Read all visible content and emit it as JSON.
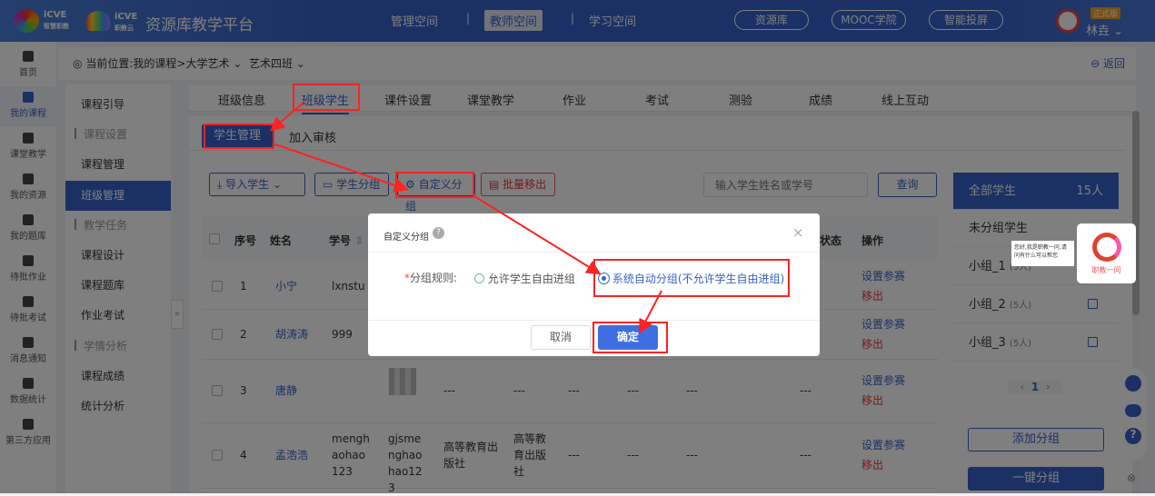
{
  "header": {
    "brand1": "iCVE",
    "brand1_sub": "智慧职教",
    "brand2": "iCVE",
    "brand2_sub": "职教云",
    "title": "资源库教学平台",
    "nav": [
      {
        "label": "管理空间"
      },
      {
        "label": "教师空间",
        "active": true
      },
      {
        "label": "学习空间"
      }
    ],
    "pills": [
      "资源库",
      "MOOC学院",
      "智能投屏"
    ],
    "badge": "正式版",
    "user": "林垚",
    "accent": "#3761c8"
  },
  "sidebar": [
    {
      "label": "首页",
      "icon": "home-icon"
    },
    {
      "label": "我的课程",
      "icon": "book-icon",
      "active": true
    },
    {
      "label": "课堂教学",
      "icon": "play-icon"
    },
    {
      "label": "我的资源",
      "icon": "library-icon"
    },
    {
      "label": "我的题库",
      "icon": "question-bank-icon"
    },
    {
      "label": "待批作业",
      "icon": "homework-icon"
    },
    {
      "label": "待批考试",
      "icon": "exam-icon"
    },
    {
      "label": "消息通知",
      "icon": "message-icon"
    },
    {
      "label": "数据统计",
      "icon": "stats-icon"
    },
    {
      "label": "第三方应用",
      "icon": "apps-icon"
    }
  ],
  "subnav": [
    {
      "label": "课程引导"
    },
    {
      "label": "课程设置",
      "section": true
    },
    {
      "label": "课程管理"
    },
    {
      "label": "班级管理",
      "active": true
    },
    {
      "label": "教学任务",
      "section": true
    },
    {
      "label": "课程设计"
    },
    {
      "label": "课程题库"
    },
    {
      "label": "作业考试"
    },
    {
      "label": "学情分析",
      "section": true
    },
    {
      "label": "课程成绩"
    },
    {
      "label": "统计分析"
    }
  ],
  "breadcrumb": {
    "prefix": "当前位置:",
    "course": "我的课程",
    "sep": ">",
    "subject": "大学艺术",
    "class": "艺术四班",
    "back": "返回"
  },
  "tabs": [
    "班级信息",
    "班级学生",
    "课件设置",
    "课堂教学",
    "作业",
    "考试",
    "测验",
    "成绩",
    "线上互动"
  ],
  "subtabs": [
    "学生管理",
    "加入审核"
  ],
  "toolbar": {
    "import": "导入学生",
    "group": "学生分组",
    "custom": "自定义分组",
    "remove": "批量移出",
    "search_placeholder": "输入学生姓名或学号",
    "query": "查询"
  },
  "table": {
    "headers": {
      "no": "序号",
      "name": "姓名",
      "id": "学号",
      "status": "状态",
      "ops": "操作"
    },
    "rows": [
      {
        "no": "1",
        "name": "小宁",
        "id": "lxnstu",
        "cols": []
      },
      {
        "no": "2",
        "name": "胡涛涛",
        "id": "999",
        "cols": []
      },
      {
        "no": "3",
        "name": "唐静",
        "id": "",
        "cols": [
          "---",
          "---",
          "---",
          "---",
          "---",
          "---"
        ]
      },
      {
        "no": "4",
        "name": "孟浩浩",
        "id": "menghaohao123",
        "c1": "gjsmenghaohao123",
        "c2": "高等教育出版社",
        "c3": "高等教育出版社",
        "cols": [
          "---",
          "---",
          "---",
          "---"
        ]
      }
    ],
    "op1": "设置参赛",
    "op2": "移出"
  },
  "groups": {
    "all": "全部学生",
    "all_count": "15人",
    "ungrouped": "未分组学生",
    "items": [
      {
        "name": "小组_1",
        "count": "(5人)"
      },
      {
        "name": "小组_2",
        "count": "(5人)"
      },
      {
        "name": "小组_3",
        "count": "(5人)"
      }
    ],
    "page": "1",
    "add": "添加分组",
    "auto": "一键分组"
  },
  "modal": {
    "title": "自定义分组",
    "label": "分组规则:",
    "required": "*",
    "option1": "允许学生自由进组",
    "option2": "系统自动分组(不允许学生自由进组)",
    "selected": 2,
    "cancel": "取消",
    "ok": "确定"
  },
  "assistant": {
    "greeting": "您好,我是职教一问,请问有什么可以帮您",
    "name": "职教一问"
  }
}
